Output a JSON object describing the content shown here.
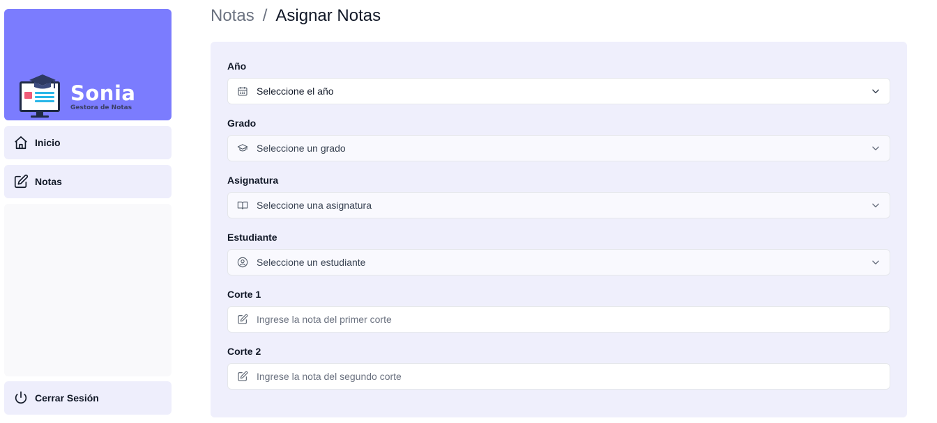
{
  "brand": {
    "name": "Sonia",
    "tagline": "Gestora de Notas",
    "background_color": "#7b7cfe"
  },
  "sidebar": {
    "items": [
      {
        "label": "Inicio",
        "icon": "home-icon"
      },
      {
        "label": "Notas",
        "icon": "edit-icon"
      }
    ],
    "logout": {
      "label": "Cerrar Sesión",
      "icon": "power-icon"
    }
  },
  "breadcrumb": {
    "parent": "Notas",
    "separator": "/",
    "current": "Asignar Notas"
  },
  "form": {
    "year": {
      "label": "Año",
      "placeholder": "Seleccione el año",
      "icon": "calendar-icon"
    },
    "grade": {
      "label": "Grado",
      "placeholder": "Seleccione un grado",
      "icon": "graduation-cap-icon"
    },
    "subject": {
      "label": "Asignatura",
      "placeholder": "Seleccione una asignatura",
      "icon": "book-icon"
    },
    "student": {
      "label": "Estudiante",
      "placeholder": "Seleccione un estudiante",
      "icon": "user-circle-icon"
    },
    "cut1": {
      "label": "Corte 1",
      "placeholder": "Ingrese la nota del primer corte",
      "icon": "pencil-icon"
    },
    "cut2": {
      "label": "Corte 2",
      "placeholder": "Ingrese la nota del segundo corte",
      "icon": "pencil-icon"
    }
  },
  "colors": {
    "accent": "#7b7cfe",
    "panel": "#efeffc",
    "nav_item": "#eeeefc"
  }
}
